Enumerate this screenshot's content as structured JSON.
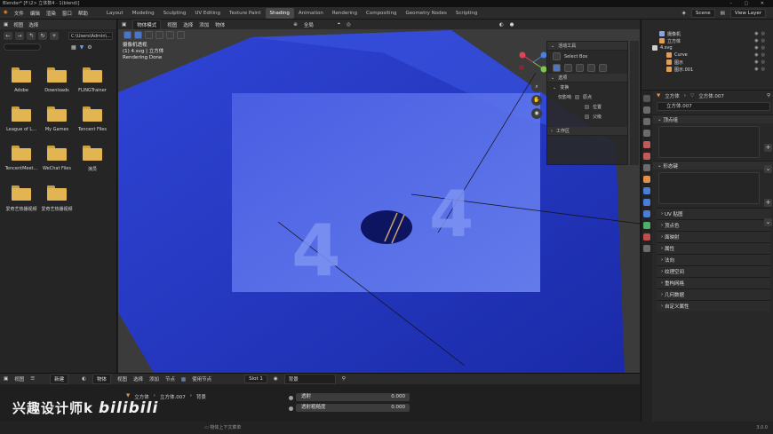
{
  "window": {
    "title": "Blender* [F:\\2> 立体数4 - 1(blend)]"
  },
  "menu": [
    "文件",
    "编辑",
    "渲染",
    "窗口",
    "帮助"
  ],
  "workspaces": [
    "Layout",
    "Modeling",
    "Sculpting",
    "UV Editing",
    "Texture Paint",
    "Shading",
    "Animation",
    "Rendering",
    "Compositing",
    "Geometry Nodes",
    "Scripting"
  ],
  "active_workspace": "Shading",
  "topright": {
    "scene": "Scene",
    "view_layer": "View Layer"
  },
  "filebrowser": {
    "header": [
      "视图",
      "选择"
    ],
    "path": "C:\\Users\\Admin\\...",
    "search_placeholder": "",
    "folders": [
      "Adobe",
      "Downloads",
      "FLINGTrainer",
      "League of L...",
      "My Games",
      "Tencent Files",
      "TencentMeet...",
      "WeChat Files",
      "演员",
      "爱奇艺热播视频",
      "爱奇艺热播视频"
    ]
  },
  "viewport": {
    "header": [
      "物体模式",
      "视图",
      "选择",
      "添加",
      "物体"
    ],
    "transform": "全局",
    "info": [
      "摄像机透视",
      "(1) 4.svg | 立方体",
      "Rendering Done"
    ]
  },
  "npanel": {
    "tool_title": "活动工具",
    "select_box": "Select Box",
    "options_title": "选项",
    "transform_title": "变换",
    "affect_only": "仅影响",
    "origins": "原点",
    "locations": "位置",
    "parents": "父级",
    "workspace": "工作区"
  },
  "outliner": {
    "rows": [
      {
        "name": "摄像机",
        "depth": 1,
        "color": "#8fa3d8"
      },
      {
        "name": "立方体",
        "depth": 1,
        "color": "#e59c54"
      },
      {
        "name": "4.svg",
        "depth": 0,
        "color": "#cfcfcf"
      },
      {
        "name": "Curve",
        "depth": 2,
        "color": "#e59c54"
      },
      {
        "name": "图示",
        "depth": 2,
        "color": "#e59c54"
      },
      {
        "name": "图示.001",
        "depth": 2,
        "color": "#e59c54"
      }
    ]
  },
  "properties": {
    "object": "立方体",
    "mesh": "立方体.007",
    "data_name": "立方体.007",
    "vertex_groups": "顶点组",
    "shape_keys": "形态键",
    "sections": [
      "UV 贴图",
      "顶点色",
      "面映射",
      "属性",
      "法向",
      "纹理空间",
      "重构网格",
      "几何数据",
      "自定义属性"
    ]
  },
  "shader": {
    "header": [
      "物体",
      "视图",
      "选择",
      "添加",
      "节点"
    ],
    "use_nodes": "使用节点",
    "slot": "Slot 1",
    "material": "背景",
    "breadcrumb": [
      "立方体",
      "立方体.007",
      "背景"
    ],
    "new_button": "新建",
    "left_header": [
      "视图"
    ],
    "rows": [
      {
        "label": "透射",
        "value": "0.000"
      },
      {
        "label": "透射粗糙度",
        "value": "0.000"
      }
    ]
  },
  "status": {
    "hint": "物体上下文菜单",
    "version": "3.0.0"
  },
  "watermark": {
    "text": "兴趣设计师k",
    "brand": "bilibili"
  }
}
